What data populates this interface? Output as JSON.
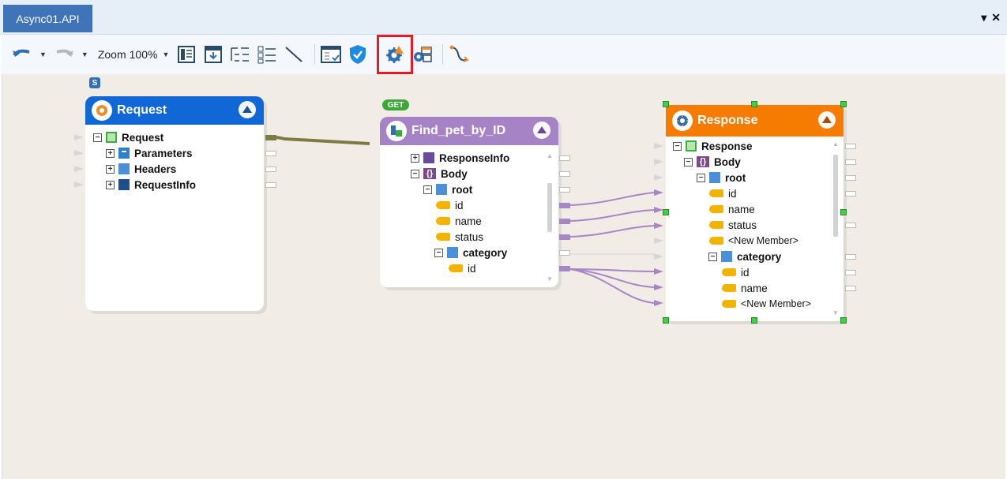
{
  "tab": {
    "title": "Async01.API",
    "menu_glyph": "▾",
    "close_glyph": "✕"
  },
  "toolbar": {
    "zoom_label": "Zoom",
    "zoom_value": "100%",
    "icons": [
      "undo-icon",
      "redo-icon",
      "layout-icon",
      "export-icon",
      "collapse-tree-icon",
      "expand-tree-icon",
      "line-icon",
      "data-icon",
      "validate-shield-icon",
      "run-settings-icon",
      "configure-icon",
      "flow-icon"
    ],
    "highlighted_icon": "run-settings-icon"
  },
  "colors": {
    "request": "#1267d6",
    "find": "#a583c4",
    "response": "#f57c00",
    "link_green": "#7c7b45",
    "link_purple": "#a786c4"
  },
  "canvas": {
    "source_badge": "S",
    "get_badge": "GET",
    "request_node": {
      "title": "Request",
      "rows": [
        {
          "label": "Request",
          "toggle": "−"
        },
        {
          "label": "Parameters",
          "toggle": "+"
        },
        {
          "label": "Headers",
          "toggle": "+"
        },
        {
          "label": "RequestInfo",
          "toggle": "+"
        }
      ]
    },
    "find_node": {
      "title": "Find_pet_by_ID",
      "rows": [
        {
          "label": "ResponseInfo",
          "toggle": "+"
        },
        {
          "label": "Body",
          "toggle": "−"
        },
        {
          "label": "root",
          "toggle": "−"
        },
        {
          "label": "id"
        },
        {
          "label": "name"
        },
        {
          "label": "status"
        },
        {
          "label": "category",
          "toggle": "−"
        },
        {
          "label": "id"
        }
      ]
    },
    "response_node": {
      "title": "Response",
      "rows": [
        {
          "label": "Response",
          "toggle": "−"
        },
        {
          "label": "Body",
          "toggle": "−"
        },
        {
          "label": "root",
          "toggle": "−"
        },
        {
          "label": "id"
        },
        {
          "label": "name"
        },
        {
          "label": "status"
        },
        {
          "label": "<New Member>"
        },
        {
          "label": "category",
          "toggle": "−"
        },
        {
          "label": "id"
        },
        {
          "label": "name"
        },
        {
          "label": "<New Member>"
        }
      ]
    }
  }
}
